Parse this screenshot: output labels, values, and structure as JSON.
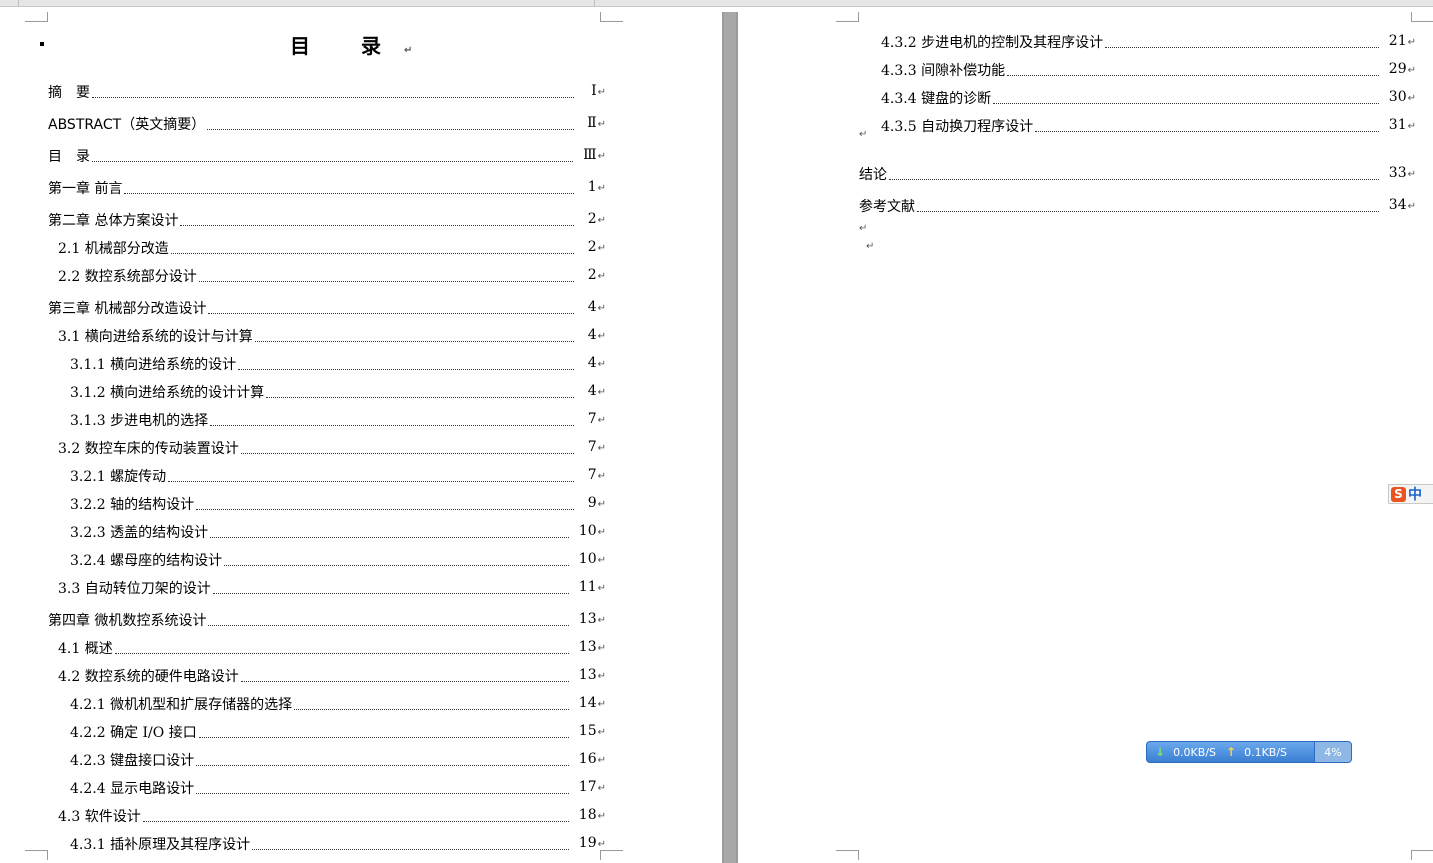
{
  "title": "目  录",
  "left_toc": [
    {
      "label": "摘　要",
      "page": "Ⅰ",
      "level": 1
    },
    {
      "label": "ABSTRACT（英文摘要）",
      "page": "Ⅱ",
      "level": 1
    },
    {
      "label": "目　录",
      "page": "Ⅲ",
      "level": 1
    },
    {
      "label": "第一章  前言",
      "page": "1",
      "level": 1
    },
    {
      "label": "第二章  总体方案设计",
      "page": "2",
      "level": 1
    },
    {
      "label": "2.1 机械部分改造",
      "page": "2",
      "level": 2
    },
    {
      "label": "2.2 数控系统部分设计",
      "page": "2",
      "level": 2
    },
    {
      "label": "第三章  机械部分改造设计",
      "page": "4",
      "level": 1
    },
    {
      "label": "3.1 横向进给系统的设计与计算",
      "page": "4",
      "level": 2
    },
    {
      "label": "3.1.1 横向进给系统的设计",
      "page": "4",
      "level": 3
    },
    {
      "label": "3.1.2 横向进给系统的设计计算",
      "page": "4",
      "level": 3
    },
    {
      "label": "3.1.3 步进电机的选择",
      "page": "7",
      "level": 3
    },
    {
      "label": "3.2 数控车床的传动装置设计",
      "page": "7",
      "level": 2
    },
    {
      "label": "3.2.1 螺旋传动",
      "page": "7",
      "level": 3
    },
    {
      "label": "3.2.2 轴的结构设计",
      "page": "9",
      "level": 3
    },
    {
      "label": "3.2.3 透盖的结构设计",
      "page": "10",
      "level": 3
    },
    {
      "label": "3.2.4 螺母座的结构设计",
      "page": "10",
      "level": 3
    },
    {
      "label": "3.3 自动转位刀架的设计",
      "page": "11",
      "level": 2
    },
    {
      "label": "第四章  微机数控系统设计",
      "page": "13",
      "level": 1
    },
    {
      "label": "4.1 概述",
      "page": "13",
      "level": 2
    },
    {
      "label": "4.2 数控系统的硬件电路设计",
      "page": "13",
      "level": 2
    },
    {
      "label": "4.2.1 微机机型和扩展存储器的选择",
      "page": "14",
      "level": 3
    },
    {
      "label": "4.2.2 确定 I/O 接口",
      "page": "15",
      "level": 3
    },
    {
      "label": "4.2.3 键盘接口设计",
      "page": "16",
      "level": 3
    },
    {
      "label": "4.2.4 显示电路设计",
      "page": "17",
      "level": 3
    },
    {
      "label": "4.3 软件设计",
      "page": "18",
      "level": 2
    },
    {
      "label": "4.3.1 插补原理及其程序设计",
      "page": "19",
      "level": 3
    }
  ],
  "right_toc": [
    {
      "label": "4.3.2 步进电机的控制及其程序设计",
      "page": "21",
      "level": 3
    },
    {
      "label": "4.3.3 间隙补偿功能",
      "page": "29",
      "level": 3
    },
    {
      "label": "4.3.4 键盘的诊断",
      "page": "30",
      "level": 3
    },
    {
      "label": "4.3.5 自动换刀程序设计",
      "page": "31",
      "level": 3
    },
    {
      "label": "结论",
      "page": "33",
      "level": 1
    },
    {
      "label": "参考文献",
      "page": "34",
      "level": 1
    }
  ],
  "paragraph_mark": "↵",
  "ime": {
    "logo": "S",
    "mode": "中"
  },
  "net_monitor": {
    "down": "0.0KB/S",
    "up": "0.1KB/S",
    "percent": "4%"
  }
}
